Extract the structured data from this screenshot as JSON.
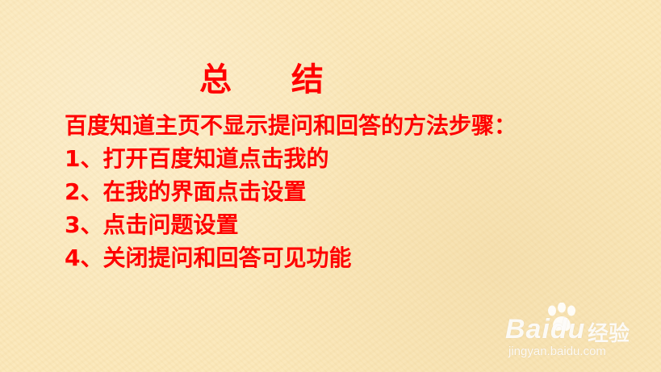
{
  "slide": {
    "title": "总 结",
    "lines": [
      "百度知道主页不显示提问和回答的方法步骤：",
      "1、打开百度知道点击我的",
      "2、在我的界面点击设置",
      "3、点击问题设置",
      "4、关闭提问和回答可见功能"
    ]
  },
  "watermark": {
    "logo": "Baidu",
    "jingyan": "经验",
    "url": "jingyan.baidu.com"
  },
  "colors": {
    "text": "#ff0000",
    "background": "#fbe7b8"
  }
}
